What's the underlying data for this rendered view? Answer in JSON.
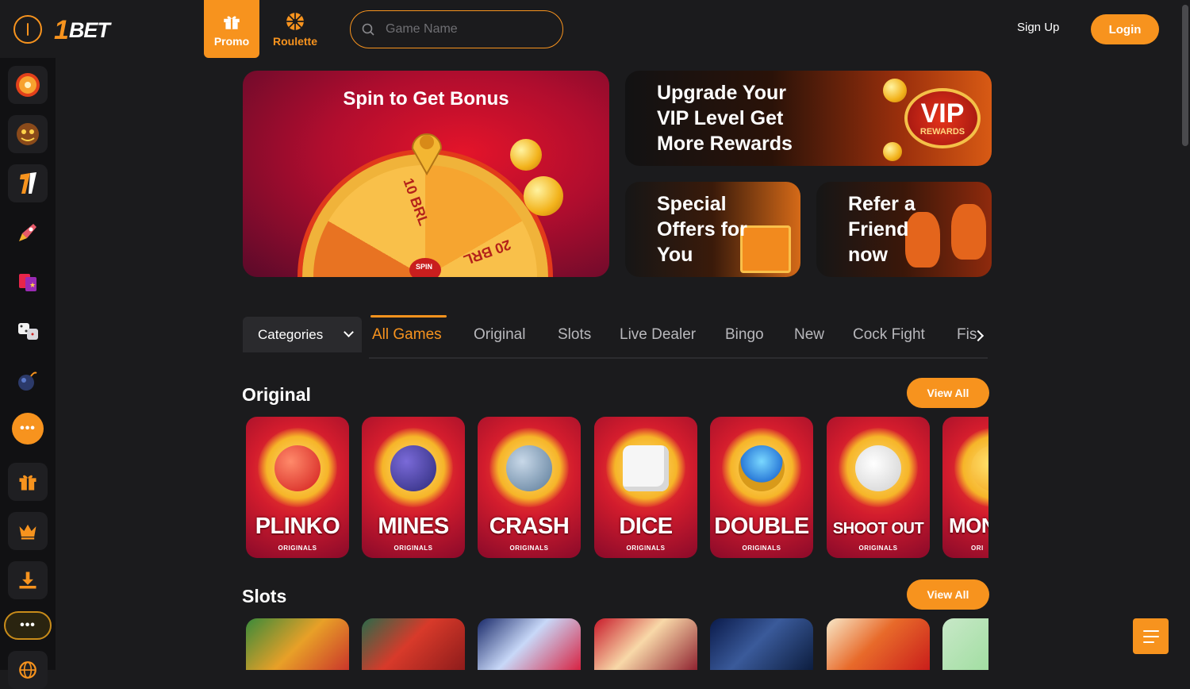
{
  "header": {
    "logo_text": "1BET",
    "logo_digit": "1",
    "logo_word": "BET",
    "nav": [
      {
        "label": "Promo",
        "icon": "gift-icon",
        "active": true
      },
      {
        "label": "Roulette",
        "icon": "roulette-icon",
        "active": false
      }
    ],
    "search": {
      "placeholder": "Game Name",
      "value": ""
    },
    "signup_label": "Sign Up",
    "login_label": "Login"
  },
  "sidebar": {
    "items": [
      {
        "icon": "roulette-wheel-icon"
      },
      {
        "icon": "monster-game-icon"
      },
      {
        "icon": "1bet-logo-icon"
      },
      {
        "icon": "rocket-icon"
      },
      {
        "icon": "cards-icon"
      },
      {
        "icon": "dice-icon"
      },
      {
        "icon": "bomb-icon"
      },
      {
        "icon": "more-dots-icon",
        "label": "•••"
      },
      {
        "icon": "gift-icon"
      },
      {
        "icon": "crown-icon"
      },
      {
        "icon": "download-icon"
      },
      {
        "icon": "more-dots-icon",
        "label": "•••"
      },
      {
        "icon": "globe-icon"
      }
    ]
  },
  "banners": {
    "spin": {
      "title": "Spin to Get Bonus",
      "label_a": "10 BRL",
      "label_b": "20 BRL",
      "spin_text": "SPIN"
    },
    "vip": {
      "line1": "Upgrade Your",
      "line2": "VIP Level Get",
      "line3": "More Rewards",
      "badge_main": "VIP",
      "badge_sub": "REWARDS"
    },
    "offers": {
      "line1": "Special",
      "line2": "Offers for",
      "line3": "You"
    },
    "refer": {
      "line1": "Refer a",
      "line2": "Friend",
      "line3": "now"
    }
  },
  "categories": {
    "dropdown_label": "Categories",
    "tabs": [
      "All Games",
      "Original",
      "Slots",
      "Live Dealer",
      "Bingo",
      "New",
      "Cock Fight",
      "Fis"
    ],
    "active_tab": "All Games"
  },
  "sections": {
    "original": {
      "title": "Original",
      "view_all": "View All",
      "games": [
        {
          "name": "PLINKO",
          "sub": "ORIGINALS"
        },
        {
          "name": "MINES",
          "sub": "ORIGINALS"
        },
        {
          "name": "CRASH",
          "sub": "ORIGINALS"
        },
        {
          "name": "DICE",
          "sub": "ORIGINALS"
        },
        {
          "name": "DOUBLE",
          "sub": "ORIGINALS"
        },
        {
          "name": "SHOOT OUT",
          "sub": "ORIGINALS"
        },
        {
          "name": "MON",
          "sub": "ORI"
        }
      ]
    },
    "slots": {
      "title": "Slots",
      "view_all": "View All"
    }
  },
  "colors": {
    "accent": "#f7931e",
    "background": "#1b1b1d",
    "sidebar": "#111113"
  }
}
